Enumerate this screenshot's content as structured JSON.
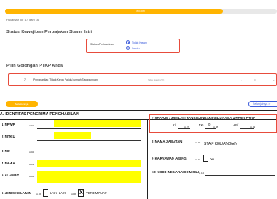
{
  "progress": {
    "label": "80.00%",
    "fraction": 0.8
  },
  "page_counter": "Halaman ke 12 dari 16",
  "status_section": {
    "title": "Status Kewajiban Perpajakan Suami Istri",
    "field_label": "Status Perkawinan",
    "options": [
      {
        "label": "Tidak Kawin",
        "selected": true
      },
      {
        "label": "Kawin",
        "selected": false
      }
    ]
  },
  "ptkp_section": {
    "title": "Pilih Golongan PTKP Anda",
    "row_number": "7",
    "row_label": "Penghasilan Tidak Kena Pajak/Jumlah Tanggungan",
    "select_placeholder": "Tidak kawin/TK",
    "select_value": "0"
  },
  "nav": {
    "prev_label": "Sebelumnya",
    "next_label": "Selanjutnya >"
  },
  "form": {
    "section_title": "A. IDENTITAS PENERIMA PENGHASILAN",
    "left_fields": [
      {
        "num": "1",
        "label": "NPWP",
        "code": "A.01"
      },
      {
        "num": "2",
        "label": "NITKU",
        "code": ""
      },
      {
        "num": "3",
        "label": "NIK",
        "code": "A.02"
      },
      {
        "num": "4",
        "label": "NAMA",
        "code": "A.03"
      },
      {
        "num": "5",
        "label": "ALAMAT",
        "code": "A.04"
      },
      {
        "num": "6",
        "label": "JENIS KELAMIN",
        "code": "A.05"
      }
    ],
    "gender": {
      "male": "LAKI-LAKI",
      "female_code": "A.06",
      "female": "PEREMPUAN",
      "checked_mark": "X"
    },
    "status_title": "STATUS / JUMLAH TANGGUNGAN KELUARGA UNTUK PTKP",
    "status_items": [
      {
        "label": "K/",
        "code": "A.07"
      },
      {
        "label": "TK/",
        "value": "0",
        "code": "A.08"
      },
      {
        "label": "HB/",
        "code": "A.09"
      }
    ],
    "right_fields": [
      {
        "num": "8",
        "label": "NAMA JABATAN",
        "code": "A.10",
        "value": "STAF KEUANGAN"
      },
      {
        "num": "9",
        "label": "KARYAWAN ASING",
        "code": "A.11",
        "value": "YA"
      },
      {
        "num": "10",
        "label": "KODE NEGARA DOMISILI",
        "code": "A.12",
        "value": ""
      }
    ]
  },
  "colors": {
    "accent": "#ffb400",
    "primary": "#3b5bdb",
    "highlight": "#ffff00",
    "alert": "#e74c3c"
  }
}
